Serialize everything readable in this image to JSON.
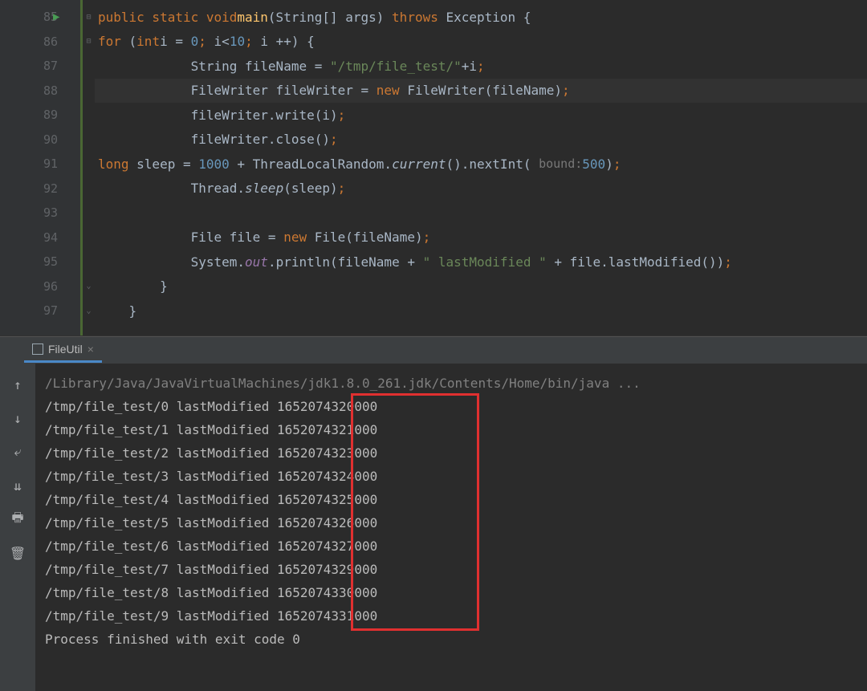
{
  "editor": {
    "lines": [
      {
        "num": 85,
        "run": true,
        "fold": "open",
        "html": "    <span class='kw'>public static void</span> <span class='mname'>main</span>(String[] args) <span class='kw'>throws</span> Exception {"
      },
      {
        "num": 86,
        "fold": "open",
        "html": "        <span class='kw'>for</span> (<span class='kw'>int</span> <span class='type'>i</span> = <span class='num'>0</span><span class='semi'>;</span> i&lt;<span class='num'>10</span><span class='semi'>;</span> i ++) {"
      },
      {
        "num": 87,
        "html": "            String fileName = <span class='str'>\"/tmp/file_test/\"</span>+<span class='type'>i</span><span class='semi'>;</span>"
      },
      {
        "num": 88,
        "highlight": true,
        "html": "            FileWriter fileWriter = <span class='kw'>new</span> FileWriter(fileName)<span class='semi'>;</span>"
      },
      {
        "num": 89,
        "html": "            fileWriter.write(i)<span class='semi'>;</span>"
      },
      {
        "num": 90,
        "html": "            fileWriter.close()<span class='semi'>;</span>"
      },
      {
        "num": 91,
        "html": "            <span class='kw'>long</span> sleep = <span class='num'>1000</span> + ThreadLocalRandom.<span class='italic'>current</span>().nextInt( <span class='hint'>bound:</span> <span class='num'>500</span>)<span class='semi'>;</span>"
      },
      {
        "num": 92,
        "html": "            Thread.<span class='italic'>sleep</span>(sleep)<span class='semi'>;</span>"
      },
      {
        "num": 93,
        "html": ""
      },
      {
        "num": 94,
        "html": "            File file = <span class='kw'>new</span> File(fileName)<span class='semi'>;</span>"
      },
      {
        "num": 95,
        "html": "            System.<span class='fld'>out</span>.println(fileName + <span class='str'>\" lastModified \"</span> + file.lastModified())<span class='semi'>;</span>"
      },
      {
        "num": 96,
        "fold": "close",
        "html": "        }"
      },
      {
        "num": 97,
        "fold": "close",
        "html": "    }"
      }
    ]
  },
  "runTab": {
    "label": "FileUtil",
    "close": "×"
  },
  "console": {
    "cmd": "/Library/Java/JavaVirtualMachines/jdk1.8.0_261.jdk/Contents/Home/bin/java ...",
    "lines": [
      "/tmp/file_test/0 lastModified 1652074320000",
      "/tmp/file_test/1 lastModified 1652074321000",
      "/tmp/file_test/2 lastModified 1652074323000",
      "/tmp/file_test/3 lastModified 1652074324000",
      "/tmp/file_test/4 lastModified 1652074325000",
      "/tmp/file_test/5 lastModified 1652074326000",
      "/tmp/file_test/6 lastModified 1652074327000",
      "/tmp/file_test/7 lastModified 1652074329000",
      "/tmp/file_test/8 lastModified 1652074330000",
      "/tmp/file_test/9 lastModified 1652074331000"
    ],
    "blank": "",
    "footer": "Process finished with exit code 0"
  },
  "icons": {
    "up": "↑",
    "down": "↓",
    "wrap": "⤶",
    "scroll": "⇊",
    "print": "🖶",
    "trash": "🗑"
  }
}
